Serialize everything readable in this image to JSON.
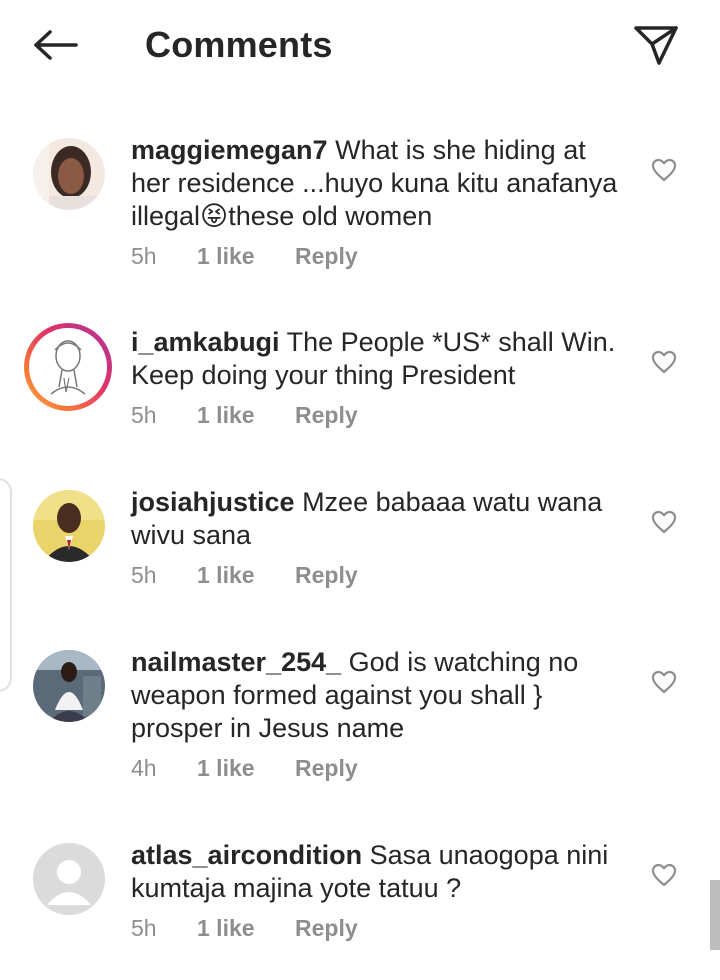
{
  "header": {
    "title": "Comments"
  },
  "comments": [
    {
      "username": "maggiemegan7",
      "text": " What is she hiding at her residence ...huyo kuna kitu anafanya illegal",
      "emoji": "😝",
      "text_after": "these old women",
      "time": "5h",
      "likes": "1 like",
      "reply": "Reply"
    },
    {
      "username": "i_amkabugi",
      "text": " The People *US* shall Win. Keep doing your thing President",
      "time": "5h",
      "likes": "1 like",
      "reply": "Reply"
    },
    {
      "username": "josiahjustice",
      "text": " Mzee babaaa watu wana wivu sana",
      "time": "5h",
      "likes": "1 like",
      "reply": "Reply"
    },
    {
      "username": "nailmaster_254_",
      "text": " God is watching no weapon  formed against you shall } prosper in Jesus name",
      "time": "4h",
      "likes": "1 like",
      "reply": "Reply"
    },
    {
      "username": "atlas_aircondition",
      "text": " Sasa unaogopa nini kumtaja majina yote tatuu ?",
      "time": "5h",
      "likes": "1 like",
      "reply": "Reply"
    }
  ]
}
